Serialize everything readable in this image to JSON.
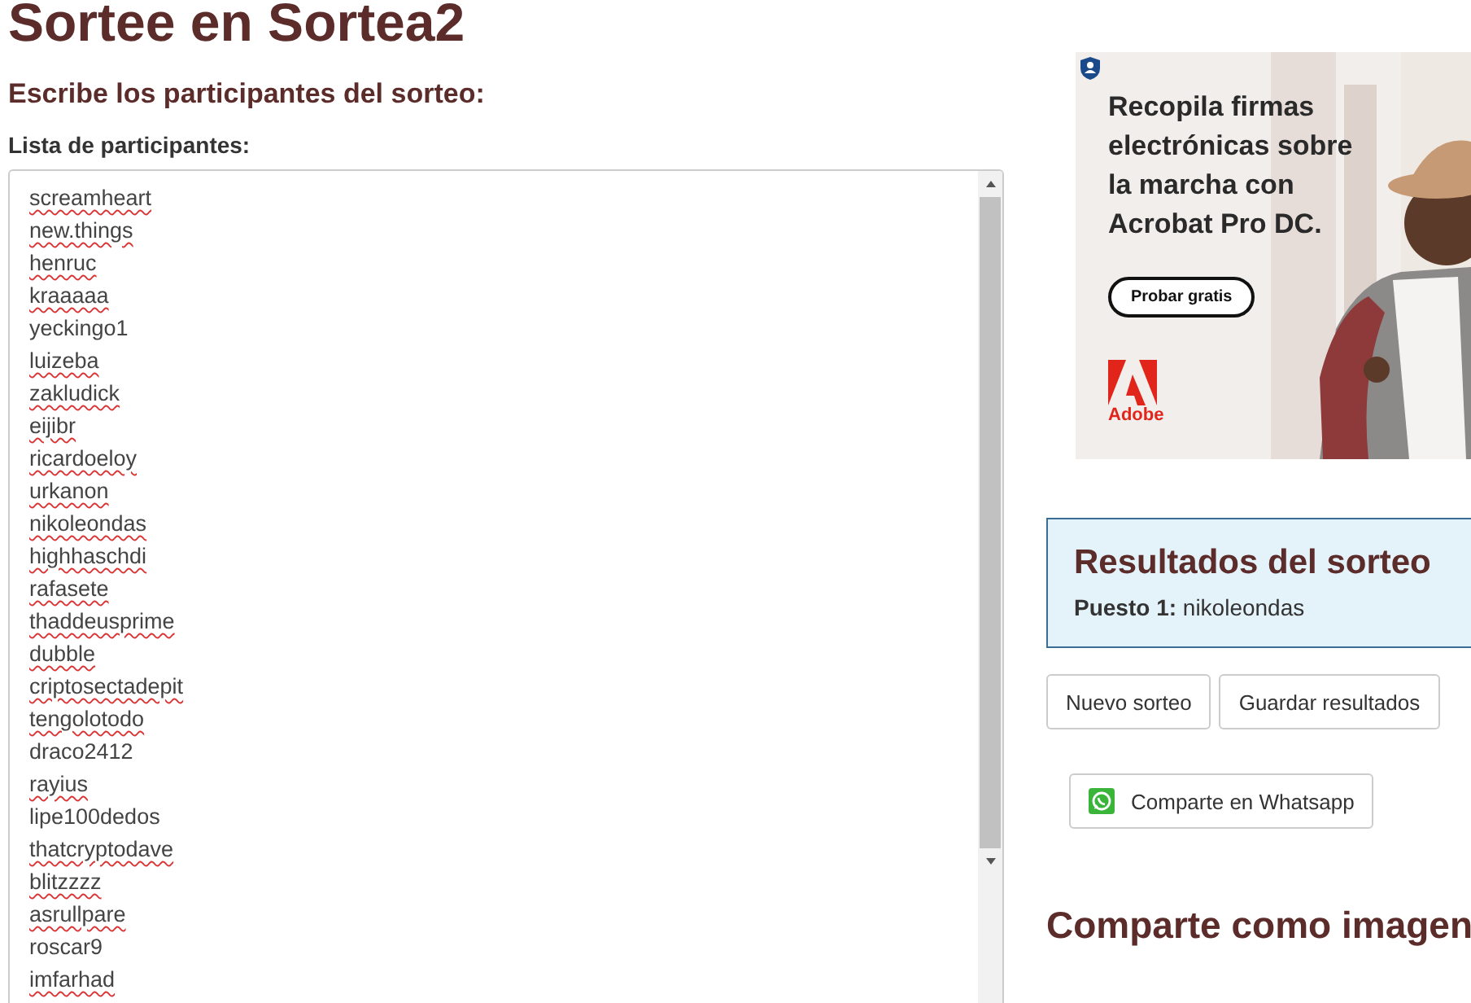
{
  "page_title": "Sortee en Sortea2",
  "section_heading": "Escribe los participantes del sorteo:",
  "list_label": "Lista de participantes:",
  "participants": [
    {
      "name": "screamheart",
      "misspelled": true
    },
    {
      "name": "new.things",
      "misspelled": true
    },
    {
      "name": "henruc",
      "misspelled": true
    },
    {
      "name": "kraaaaa",
      "misspelled": true
    },
    {
      "name": "yeckingo1",
      "misspelled": false
    },
    {
      "name": "luizeba",
      "misspelled": true
    },
    {
      "name": "zakludick",
      "misspelled": true
    },
    {
      "name": "eijibr",
      "misspelled": true
    },
    {
      "name": "ricardoeloy",
      "misspelled": true
    },
    {
      "name": "urkanon",
      "misspelled": true
    },
    {
      "name": "nikoleondas",
      "misspelled": true
    },
    {
      "name": "highhaschdi",
      "misspelled": true
    },
    {
      "name": "rafasete",
      "misspelled": true
    },
    {
      "name": "thaddeusprime",
      "misspelled": true
    },
    {
      "name": "dubble",
      "misspelled": true
    },
    {
      "name": "criptosectadepit",
      "misspelled": true
    },
    {
      "name": "tengolotodo",
      "misspelled": true
    },
    {
      "name": "draco2412",
      "misspelled": false
    },
    {
      "name": "rayius",
      "misspelled": true
    },
    {
      "name": "lipe100dedos",
      "misspelled": false
    },
    {
      "name": "thatcryptodave",
      "misspelled": true
    },
    {
      "name": "blitzzzz",
      "misspelled": true
    },
    {
      "name": "asrullpare",
      "misspelled": true
    },
    {
      "name": "roscar9",
      "misspelled": false
    },
    {
      "name": "imfarhad",
      "misspelled": true
    }
  ],
  "ad": {
    "headline": "Recopila firmas electrónicas sobre la marcha con Acrobat Pro DC.",
    "cta": "Probar gratis",
    "brand": "Adobe"
  },
  "results": {
    "title": "Resultados del sorteo",
    "entries": [
      {
        "label": "Puesto 1:",
        "value": "nikoleondas"
      }
    ]
  },
  "actions": [
    "Nuevo sorteo",
    "Guardar resultados"
  ],
  "share_button": "Comparte en Whatsapp",
  "share_image_heading": "Comparte como imagen"
}
